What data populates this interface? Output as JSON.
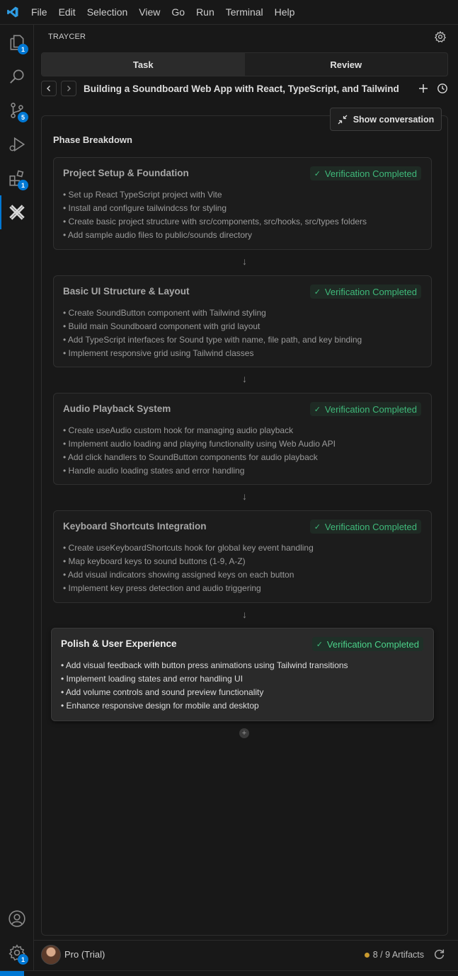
{
  "menu": [
    "File",
    "Edit",
    "Selection",
    "View",
    "Go",
    "Run",
    "Terminal",
    "Help"
  ],
  "activity": {
    "explorer_badge": "1",
    "scm_badge": "5",
    "extensions_badge": "1",
    "settings_badge": "1"
  },
  "panel": {
    "title": "TRAYCER",
    "tabs": [
      "Task",
      "Review"
    ],
    "task_title": "Building a Soundboard Web App with React, TypeScript, and Tailwind",
    "show_conversation": "Show conversation",
    "phase_heading": "Phase Breakdown"
  },
  "phases": [
    {
      "title": "Project Setup & Foundation",
      "status": "Verification Completed",
      "items": [
        "Set up React TypeScript project with Vite",
        "Install and configure tailwindcss for styling",
        "Create basic project structure with src/components, src/hooks, src/types folders",
        "Add sample audio files to public/sounds directory"
      ]
    },
    {
      "title": "Basic UI Structure & Layout",
      "status": "Verification Completed",
      "items": [
        "Create SoundButton component with Tailwind styling",
        "Build main Soundboard component with grid layout",
        "Add TypeScript interfaces for Sound type with name, file path, and key binding",
        "Implement responsive grid using Tailwind classes"
      ]
    },
    {
      "title": "Audio Playback System",
      "status": "Verification Completed",
      "items": [
        "Create useAudio custom hook for managing audio playback",
        "Implement audio loading and playing functionality using Web Audio API",
        "Add click handlers to SoundButton components for audio playback",
        "Handle audio loading states and error handling"
      ]
    },
    {
      "title": "Keyboard Shortcuts Integration",
      "status": "Verification Completed",
      "items": [
        "Create useKeyboardShortcuts hook for global key event handling",
        "Map keyboard keys to sound buttons (1-9, A-Z)",
        "Add visual indicators showing assigned keys on each button",
        "Implement key press detection and audio triggering"
      ]
    },
    {
      "title": "Polish & User Experience",
      "status": "Verification Completed",
      "items": [
        "Add visual feedback with button press animations using Tailwind transitions",
        "Implement loading states and error handling UI",
        "Add volume controls and sound preview functionality",
        "Enhance responsive design for mobile and desktop"
      ]
    }
  ],
  "footer": {
    "plan": "Pro (Trial)",
    "artifacts": "8 / 9 Artifacts"
  },
  "colors": {
    "accent": "#0078d4",
    "success": "#3fb97a",
    "artifact_dot": "#c99a2e"
  }
}
